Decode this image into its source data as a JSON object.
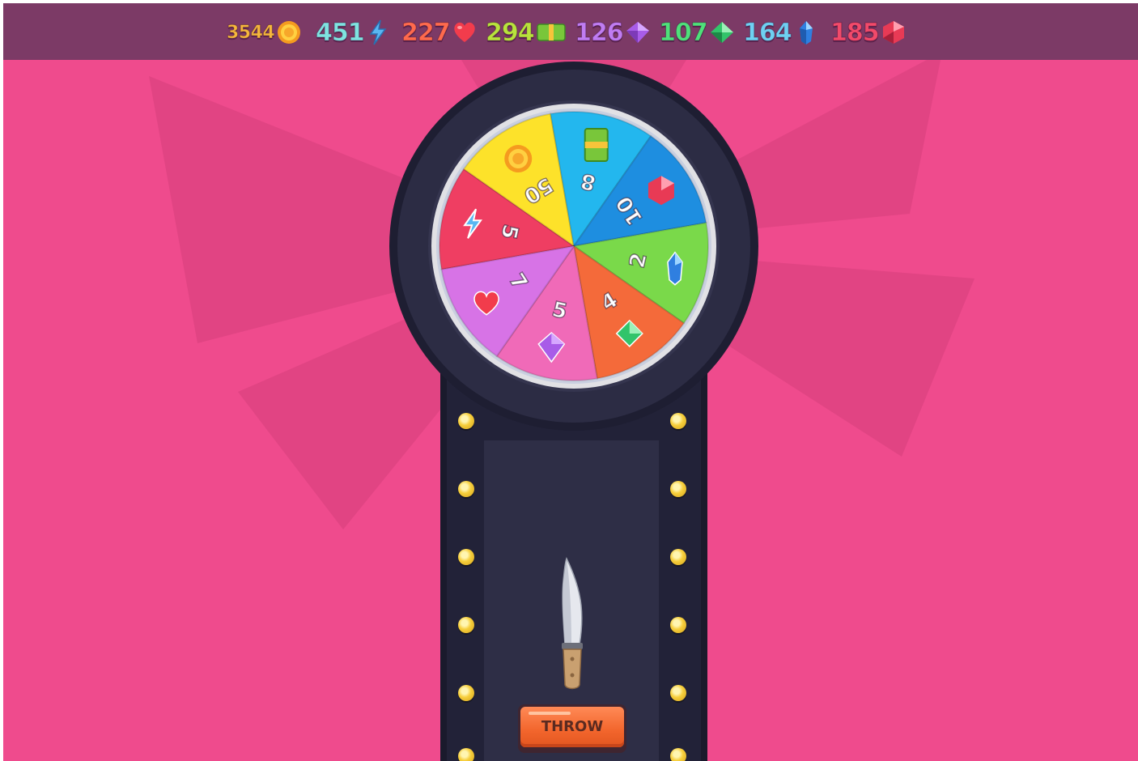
{
  "resources": [
    {
      "value": "3544",
      "icon": "coin-icon",
      "color": "#f6b73c"
    },
    {
      "value": "451",
      "icon": "lightning-icon",
      "color": "#7fe3e0"
    },
    {
      "value": "227",
      "icon": "heart-icon",
      "color": "#ff6a4d"
    },
    {
      "value": "294",
      "icon": "cash-icon",
      "color": "#b8e33c"
    },
    {
      "value": "126",
      "icon": "purple-gem-icon",
      "color": "#c07cf2"
    },
    {
      "value": "107",
      "icon": "green-gem-icon",
      "color": "#4fe07a"
    },
    {
      "value": "164",
      "icon": "blue-crystal-icon",
      "color": "#6fd0f2"
    },
    {
      "value": "185",
      "icon": "ruby-icon",
      "color": "#f24a6a"
    }
  ],
  "wheel": {
    "segments": [
      {
        "value": "5",
        "icon": "lightning-icon",
        "color": "#ef3e62"
      },
      {
        "value": "50",
        "icon": "coin-icon",
        "color": "#fde22a"
      },
      {
        "value": "8",
        "icon": "cash-icon",
        "color": "#23b7ee"
      },
      {
        "value": "10",
        "icon": "ruby-icon",
        "color": "#1e8ee0"
      },
      {
        "value": "2",
        "icon": "blue-crystal-icon",
        "color": "#7ad94a"
      },
      {
        "value": "4",
        "icon": "green-gem-icon",
        "color": "#f46a3a"
      },
      {
        "value": "5",
        "icon": "purple-gem-icon",
        "color": "#f06ab8"
      },
      {
        "value": "7",
        "icon": "heart-icon",
        "color": "#d773e6"
      }
    ]
  },
  "knife": {
    "icon": "knife-icon"
  },
  "throw_button": {
    "label": "THROW"
  },
  "colors": {
    "background": "#ef4b8d",
    "topbar": "#7c3a66",
    "machine_dark": "#2a2a40",
    "button": "#f2652c"
  }
}
